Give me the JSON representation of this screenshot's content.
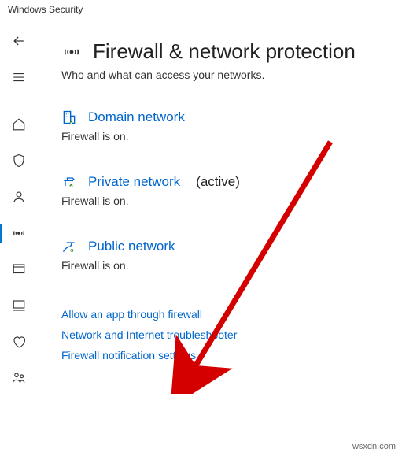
{
  "titlebar": "Windows Security",
  "page": {
    "title": "Firewall & network protection",
    "subtitle": "Who and what can access your networks."
  },
  "networks": {
    "domain": {
      "label": "Domain network",
      "status": "Firewall is on."
    },
    "private": {
      "label": "Private network",
      "active_tag": "(active)",
      "status": "Firewall is on."
    },
    "public": {
      "label": "Public network",
      "status": "Firewall is on."
    }
  },
  "links": {
    "allow_app": "Allow an app through firewall",
    "troubleshooter": "Network and Internet troubleshooter",
    "notifications": "Firewall notification settings"
  },
  "watermark": "wsxdn.com"
}
